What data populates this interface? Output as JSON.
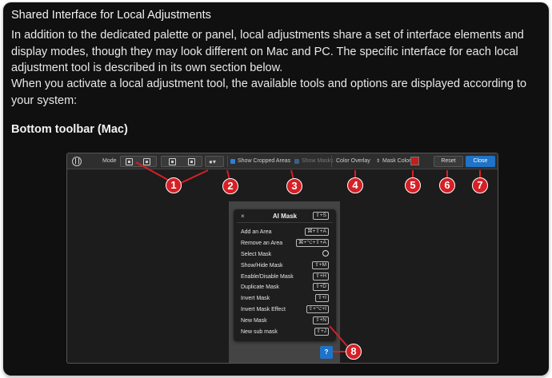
{
  "heading": "Shared Interface for Local Adjustments",
  "paragraph1": "In addition to the dedicated palette or panel, local adjustments share a set of interface elements and display modes, though they may look different on Mac and PC. The specific interface for each local adjustment tool is described in its own section below.",
  "paragraph2": "When you activate a local adjustment tool, the available tools and options are displayed according to your system:",
  "subheading": "Bottom toolbar (Mac)",
  "toolbar": {
    "mode_label": "Mode",
    "show_cropped_label": "Show Cropped Areas",
    "show_masks_label": "Show Masks",
    "overlay_select": "Color Overlay",
    "mask_color_label": "Mask Color",
    "mask_color": "#c41e1e",
    "reset_label": "Reset",
    "close_label": "Close",
    "accent_color": "#1f73c8"
  },
  "ai_panel": {
    "title": "AI Mask",
    "close_symbol": "×",
    "title_shortcut": "⇧+S",
    "items": [
      {
        "label": "Add an Area",
        "shortcut": "⌘+⇧+A"
      },
      {
        "label": "Remove an Area",
        "shortcut": "⌘+⌥+⇧+A"
      },
      {
        "label": "Select Mask",
        "icon": "lasso-cursor-icon"
      },
      {
        "label": "Show/Hide Mask",
        "shortcut": "⇧+M"
      },
      {
        "label": "Enable/Disable Mask",
        "shortcut": "⇧+H"
      },
      {
        "label": "Duplicate Mask",
        "shortcut": "⇧+D"
      },
      {
        "label": "Invert Mask",
        "shortcut": "⇧+I"
      },
      {
        "label": "Invert Mask Effect",
        "shortcut": "⇧+⌥+I"
      },
      {
        "label": "New Mask",
        "shortcut": "⇧+N"
      },
      {
        "label": "New sub mask",
        "shortcut": "⇧+J"
      }
    ],
    "help_label": "?"
  },
  "callouts": [
    "1",
    "2",
    "3",
    "4",
    "5",
    "6",
    "7",
    "8"
  ],
  "callout_color": "#d61f26"
}
